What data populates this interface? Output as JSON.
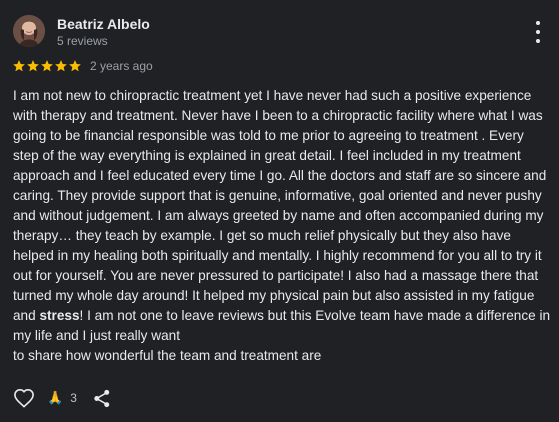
{
  "reviewer": {
    "name": "Beatriz Albelo",
    "meta": "5 reviews"
  },
  "rating": {
    "stars": 5,
    "max_stars": 5,
    "date": "2 years ago",
    "star_color": "#fbbc04"
  },
  "review": {
    "text_before_bold": "I am not new to chiropractic treatment yet I have never had such a positive experience with therapy and treatment. Never have I been to a chiropractic facility where what I was going to be financial responsible was told to me prior to agreeing to treatment . Every step of the way everything is explained in great detail. I feel included in my treatment approach and I feel educated every time I go. All the doctors and staff are so sincere and caring. They provide support that is genuine, informative, goal oriented and never pushy and without judgement. I am always greeted by name and often accompanied during my therapy… they teach by example. I get so much relief physically but they also have helped in my healing both spiritually and mentally. I highly recommend for you all to try it out for yourself. You are never pressured to participate! I also had a massage there that turned my whole day around! It helped my physical pain but also assisted in my fatigue and ",
    "bold_text": "stress",
    "text_after_bold": "! I am not one to leave reviews but this Evolve team have made a difference in my life and I just really want",
    "last_line": "to share how wonderful the team and treatment are"
  },
  "actions": {
    "like_icon": "heart-outline-icon",
    "reaction_emoji": "🙏",
    "reaction_count": "3",
    "share_icon": "share-icon"
  },
  "colors": {
    "background": "#202124",
    "text": "#e8eaed",
    "secondary_text": "#9aa0a6"
  }
}
